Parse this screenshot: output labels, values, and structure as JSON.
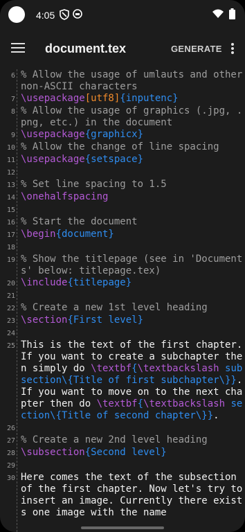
{
  "status": {
    "time": "4:05"
  },
  "appbar": {
    "title": "document.tex",
    "generate_label": "GENERATE"
  },
  "lines": [
    {
      "n": "6",
      "segs": [
        {
          "c": "c",
          "t": "% Allow the usage of umlauts and other non-ASCII characters"
        }
      ]
    },
    {
      "n": "7",
      "segs": [
        {
          "c": "k",
          "t": "\\usepackage"
        },
        {
          "c": "o",
          "t": "[utf8]"
        },
        {
          "c": "a",
          "t": "{inputenc}"
        }
      ]
    },
    {
      "n": "8",
      "segs": [
        {
          "c": "c",
          "t": "% Allow the usage of graphics (.jpg, .png, etc.) in the document"
        }
      ]
    },
    {
      "n": "9",
      "segs": [
        {
          "c": "k",
          "t": "\\usepackage"
        },
        {
          "c": "a",
          "t": "{graphicx}"
        }
      ]
    },
    {
      "n": "10",
      "segs": [
        {
          "c": "c",
          "t": "% Allow the change of line spacing"
        }
      ]
    },
    {
      "n": "11",
      "segs": [
        {
          "c": "k",
          "t": "\\usepackage"
        },
        {
          "c": "a",
          "t": "{setspace}"
        }
      ]
    },
    {
      "n": "12",
      "segs": []
    },
    {
      "n": "13",
      "segs": [
        {
          "c": "c",
          "t": "% Set line spacing to 1.5"
        }
      ]
    },
    {
      "n": "14",
      "segs": [
        {
          "c": "k",
          "t": "\\onehalfspacing"
        }
      ]
    },
    {
      "n": "15",
      "segs": []
    },
    {
      "n": "16",
      "segs": [
        {
          "c": "c",
          "t": "% Start the document"
        }
      ]
    },
    {
      "n": "17",
      "segs": [
        {
          "c": "k",
          "t": "\\begin"
        },
        {
          "c": "a",
          "t": "{document}"
        }
      ]
    },
    {
      "n": "18",
      "segs": []
    },
    {
      "n": "19",
      "segs": [
        {
          "c": "c",
          "t": "% Show the titlepage (see in 'Documents' below: titlepage.tex)"
        }
      ]
    },
    {
      "n": "20",
      "segs": [
        {
          "c": "k",
          "t": "\\include"
        },
        {
          "c": "a",
          "t": "{titlepage}"
        }
      ]
    },
    {
      "n": "21",
      "segs": []
    },
    {
      "n": "22",
      "segs": [
        {
          "c": "c",
          "t": "% Create a new 1st level heading"
        }
      ]
    },
    {
      "n": "23",
      "segs": [
        {
          "c": "k",
          "t": "\\section"
        },
        {
          "c": "a",
          "t": "{First level}"
        }
      ]
    },
    {
      "n": "24",
      "segs": []
    },
    {
      "n": "25",
      "segs": [
        {
          "c": "t",
          "t": "This is the text of the first chapter. If you want to create a subchapter then simply do "
        },
        {
          "c": "k",
          "t": "\\textbf"
        },
        {
          "c": "a",
          "t": "{"
        },
        {
          "c": "k",
          "t": "\\textbackslash"
        },
        {
          "c": "a",
          "t": " subsection\\{Title of first subchapter\\}}"
        },
        {
          "c": "t",
          "t": ". If you want to move on to the next chapter then do "
        },
        {
          "c": "k",
          "t": "\\textbf"
        },
        {
          "c": "a",
          "t": "{"
        },
        {
          "c": "k",
          "t": "\\textbackslash"
        },
        {
          "c": "a",
          "t": " section\\{Title of second chapter\\}}"
        },
        {
          "c": "t",
          "t": "."
        }
      ]
    },
    {
      "n": "26",
      "segs": []
    },
    {
      "n": "27",
      "segs": [
        {
          "c": "c",
          "t": "% Create a new 2nd level heading"
        }
      ]
    },
    {
      "n": "28",
      "segs": [
        {
          "c": "k",
          "t": "\\subsection"
        },
        {
          "c": "a",
          "t": "{Second level}"
        }
      ]
    },
    {
      "n": "29",
      "segs": []
    },
    {
      "n": "30",
      "segs": [
        {
          "c": "t",
          "t": "Here comes the text of the subsection of the first chapter. Now let's try to insert an image. Currently there exists one image with the name"
        }
      ]
    }
  ]
}
